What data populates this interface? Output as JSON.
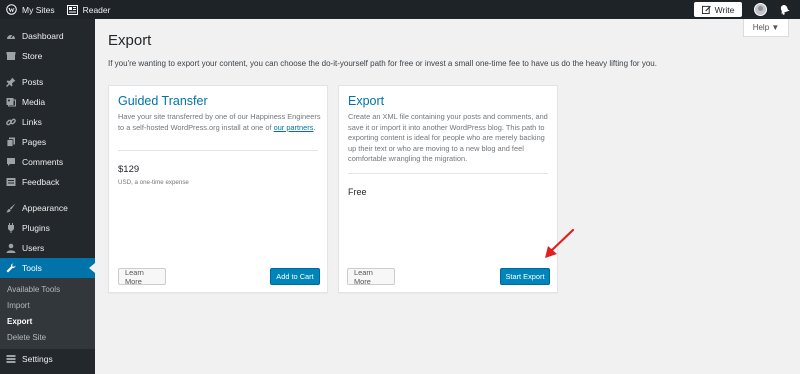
{
  "topbar": {
    "my_sites": "My Sites",
    "reader": "Reader",
    "write": "Write"
  },
  "sidebar": {
    "items": [
      {
        "label": "Dashboard",
        "icon": "dashboard-icon"
      },
      {
        "label": "Store",
        "icon": "store-icon"
      },
      {
        "label": "Posts",
        "icon": "pin-icon"
      },
      {
        "label": "Media",
        "icon": "media-icon"
      },
      {
        "label": "Links",
        "icon": "link-icon"
      },
      {
        "label": "Pages",
        "icon": "pages-icon"
      },
      {
        "label": "Comments",
        "icon": "comment-icon"
      },
      {
        "label": "Feedback",
        "icon": "feedback-icon"
      },
      {
        "label": "Appearance",
        "icon": "brush-icon"
      },
      {
        "label": "Plugins",
        "icon": "plugin-icon"
      },
      {
        "label": "Users",
        "icon": "users-icon"
      },
      {
        "label": "Tools",
        "icon": "wrench-icon"
      },
      {
        "label": "Settings",
        "icon": "settings-icon"
      }
    ],
    "tools_submenu": [
      "Available Tools",
      "Import",
      "Export",
      "Delete Site"
    ],
    "current_submenu": "Export"
  },
  "help_label": "Help ▼",
  "page": {
    "title": "Export",
    "intro": "If you're wanting to export your content, you can choose the do-it-yourself path for free or invest a small one-time fee to have us do the heavy lifting for you."
  },
  "guided": {
    "title": "Guided Transfer",
    "desc": "Have your site transferred by one of our Happiness Engineers to a self-hosted WordPress.org install at one of",
    "link": "our partners",
    "link_suffix": ".",
    "price": "$129",
    "price_note": "USD, a one-time expense",
    "learn_more": "Learn More",
    "cta": "Add to Cart"
  },
  "export": {
    "title": "Export",
    "desc": "Create an XML file containing your posts and comments, and save it or import it into another WordPress blog. This path to exporting content is ideal for people who are merely backing up their text or who are moving to a new blog and feel comfortable wrangling the migration.",
    "price": "Free",
    "learn_more": "Learn More",
    "cta": "Start Export"
  },
  "colors": {
    "accent": "#0073aa",
    "primary_button": "#0085ba",
    "sidebar_bg": "#23282d",
    "annotation_arrow": "#e02020"
  }
}
